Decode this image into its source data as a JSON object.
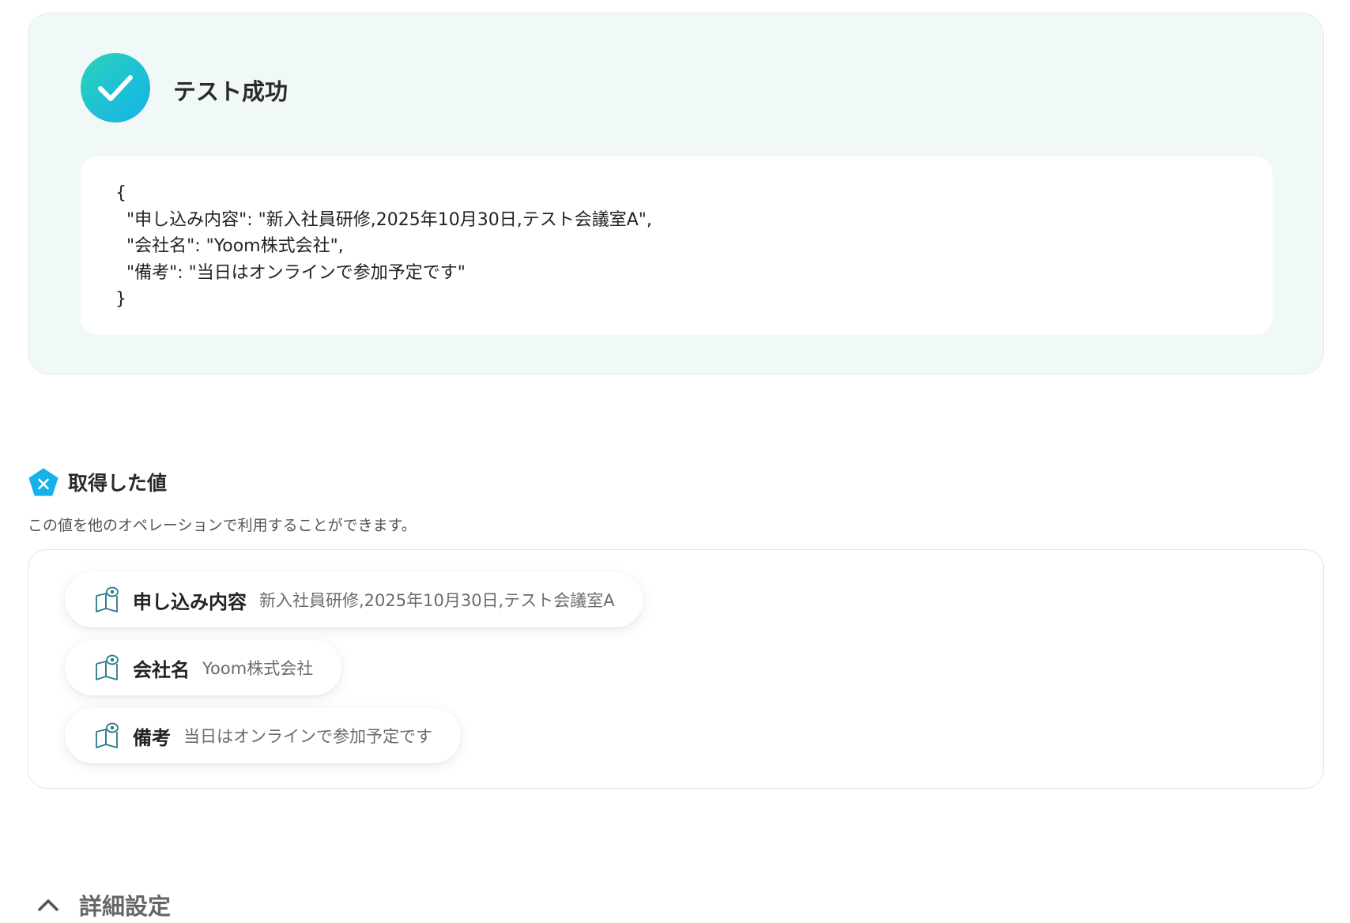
{
  "test_result": {
    "title": "テスト成功",
    "json_lines": [
      "{",
      "  \"申し込み内容\": \"新入社員研修,2025年10月30日,テスト会議室A\",",
      "  \"会社名\": \"Yoom株式会社\",",
      "  \"備考\": \"当日はオンラインで参加予定です\"",
      "}"
    ]
  },
  "retrieved": {
    "title": "取得した値",
    "description": "この値を他のオペレーションで利用することができます。",
    "items": [
      {
        "label": "申し込み内容",
        "value": "新入社員研修,2025年10月30日,テスト会議室A"
      },
      {
        "label": "会社名",
        "value": "Yoom株式会社"
      },
      {
        "label": "備考",
        "value": "当日はオンラインで参加予定です"
      }
    ]
  },
  "advanced": {
    "label": "詳細設定"
  },
  "colors": {
    "accent": "#14b2e8",
    "success_teal": "#2ad3b6",
    "card_bg": "#f1f9f8",
    "icon_stroke": "#2b7a8c"
  },
  "icons": {
    "success": "check-icon",
    "section": "variable-pentagon-icon",
    "chip": "book-eye-icon",
    "collapse": "chevron-up-icon"
  }
}
